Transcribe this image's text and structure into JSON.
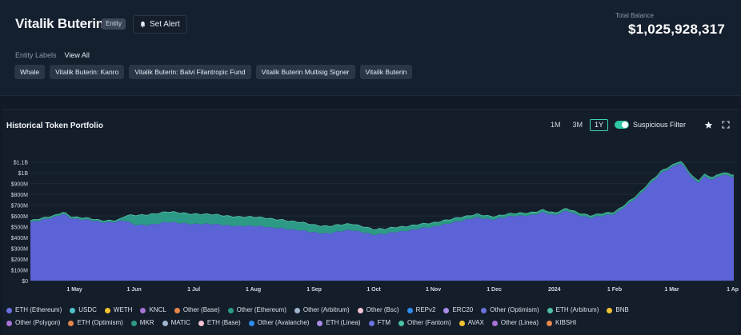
{
  "header": {
    "title": "Vitalik Buterin",
    "badge": "Entity",
    "alert_label": "Set Alert",
    "balance_label": "Total Balance",
    "balance_value": "$1,025,928,317"
  },
  "entity_labels": {
    "title": "Entity Labels",
    "view_all": "View All",
    "tags": [
      "Whale",
      "Vitalik Buterin: Kanro",
      "Vitalik Buterin: Balvi Filantropic Fund",
      "Vitalik Buterin Multisig Signer",
      "Vitalik Buterin"
    ]
  },
  "panel": {
    "title": "Historical Token Portfolio",
    "ranges": [
      "1M",
      "3M",
      "1Y"
    ],
    "active_range": "1Y",
    "suspicious_filter_label": "Suspicious Filter",
    "star_icon": "star-icon",
    "fullscreen_icon": "fullscreen-icon"
  },
  "chart_data": {
    "type": "area",
    "title": "Historical Token Portfolio",
    "y_tick_labels": [
      "$0",
      "$100M",
      "$200M",
      "$300M",
      "$400M",
      "$500M",
      "$600M",
      "$700M",
      "$800M",
      "$900M",
      "$1B",
      "$1.1B"
    ],
    "ylim": [
      0,
      1150
    ],
    "y_unit": "USD millions",
    "x_tick_labels": [
      "1 May",
      "1 Jun",
      "1 Jul",
      "1 Aug",
      "1 Sep",
      "1 Oct",
      "1 Nov",
      "1 Dec",
      "2024",
      "1 Feb",
      "1 Mar",
      "1 Apr"
    ],
    "x_tick_positions": [
      0.74,
      1.74,
      2.74,
      3.74,
      4.76,
      5.76,
      6.76,
      7.78,
      8.79,
      9.8,
      10.76,
      11.8
    ],
    "xlim": [
      0,
      11.8
    ],
    "grid": true,
    "series": [
      {
        "name": "ETH (Ethereum)",
        "color": "#5b63d6",
        "x": [
          0,
          0.2,
          0.4,
          0.55,
          0.7,
          0.85,
          1.0,
          1.2,
          1.4,
          1.6,
          1.74,
          1.9,
          2.05,
          2.3,
          2.5,
          2.7,
          2.9,
          3.1,
          3.3,
          3.5,
          3.74,
          3.95,
          4.2,
          4.4,
          4.6,
          4.76,
          5.0,
          5.2,
          5.4,
          5.6,
          5.76,
          5.95,
          6.1,
          6.3,
          6.5,
          6.76,
          6.9,
          7.1,
          7.3,
          7.5,
          7.78,
          8.0,
          8.2,
          8.4,
          8.6,
          8.79,
          9.0,
          9.2,
          9.4,
          9.6,
          9.8,
          10.0,
          10.2,
          10.4,
          10.6,
          10.76,
          10.9,
          11.0,
          11.1,
          11.2,
          11.3,
          11.45,
          11.6,
          11.8
        ],
        "values": [
          540,
          560,
          590,
          625,
          575,
          565,
          560,
          545,
          545,
          555,
          515,
          520,
          525,
          540,
          535,
          530,
          525,
          520,
          515,
          510,
          505,
          500,
          490,
          470,
          460,
          450,
          440,
          455,
          470,
          450,
          425,
          430,
          450,
          465,
          480,
          495,
          520,
          545,
          560,
          585,
          570,
          590,
          600,
          610,
          635,
          600,
          650,
          610,
          580,
          600,
          620,
          700,
          780,
          900,
          1010,
          1050,
          1090,
          1030,
          950,
          910,
          970,
          940,
          980,
          960
        ]
      },
      {
        "name": "Other (Ethereum)",
        "color": "#2c9a86",
        "x": [
          0,
          0.5,
          1.0,
          1.5,
          1.74,
          2.0,
          2.5,
          3.0,
          3.5,
          4.0,
          4.5,
          5.0,
          5.5,
          5.76,
          6.0,
          6.5,
          7.0,
          7.5,
          8.0,
          8.5,
          9.0,
          9.5,
          10.0,
          10.5,
          11.0,
          11.5,
          11.8
        ],
        "values": [
          10,
          10,
          10,
          10,
          85,
          90,
          90,
          85,
          80,
          75,
          70,
          60,
          50,
          45,
          40,
          35,
          30,
          25,
          20,
          18,
          16,
          15,
          14,
          14,
          14,
          14,
          14
        ]
      },
      {
        "name": "ETH (Arbitrum)",
        "color": "#4fc2a6",
        "x": [
          0,
          11.8
        ],
        "values": [
          8,
          8
        ]
      }
    ]
  },
  "legend": {
    "rows": [
      [
        {
          "label": "ETH (Ethereum)",
          "color": "#6b73e0"
        },
        {
          "label": "USDC",
          "color": "#4fc3c9"
        },
        {
          "label": "WETH",
          "color": "#f2c230"
        },
        {
          "label": "KNCL",
          "color": "#a873d6"
        },
        {
          "label": "Other (Base)",
          "color": "#e8874a"
        },
        {
          "label": "Other (Ethereum)",
          "color": "#2c9a86"
        },
        {
          "label": "Other (Arbitrum)",
          "color": "#9fb4cf"
        },
        {
          "label": "Other (Bsc)",
          "color": "#f5c4d6"
        },
        {
          "label": "REPv2",
          "color": "#2e8df0"
        },
        {
          "label": "ERC20",
          "color": "#a98de8"
        },
        {
          "label": "Other (Optimism)",
          "color": "#6b73e0"
        },
        {
          "label": "ETH (Arbitrum)",
          "color": "#4fc2a6"
        },
        {
          "label": "BNB",
          "color": "#f2c230"
        }
      ],
      [
        {
          "label": "Other (Polygon)",
          "color": "#a873d6"
        },
        {
          "label": "ETH (Optimism)",
          "color": "#e8874a"
        },
        {
          "label": "MKR",
          "color": "#2c9a86"
        },
        {
          "label": "MATIC",
          "color": "#9fb4cf"
        },
        {
          "label": "ETH (Base)",
          "color": "#f5c4d6"
        },
        {
          "label": "Other (Avalanche)",
          "color": "#2e8df0"
        },
        {
          "label": "ETH (Linea)",
          "color": "#a98de8"
        },
        {
          "label": "FTM",
          "color": "#6b73e0"
        },
        {
          "label": "Other (Fantom)",
          "color": "#4fc2a6"
        },
        {
          "label": "AVAX",
          "color": "#f2c230"
        },
        {
          "label": "Other (Linea)",
          "color": "#a873d6"
        },
        {
          "label": "KIBSHI",
          "color": "#e8874a"
        }
      ]
    ]
  }
}
